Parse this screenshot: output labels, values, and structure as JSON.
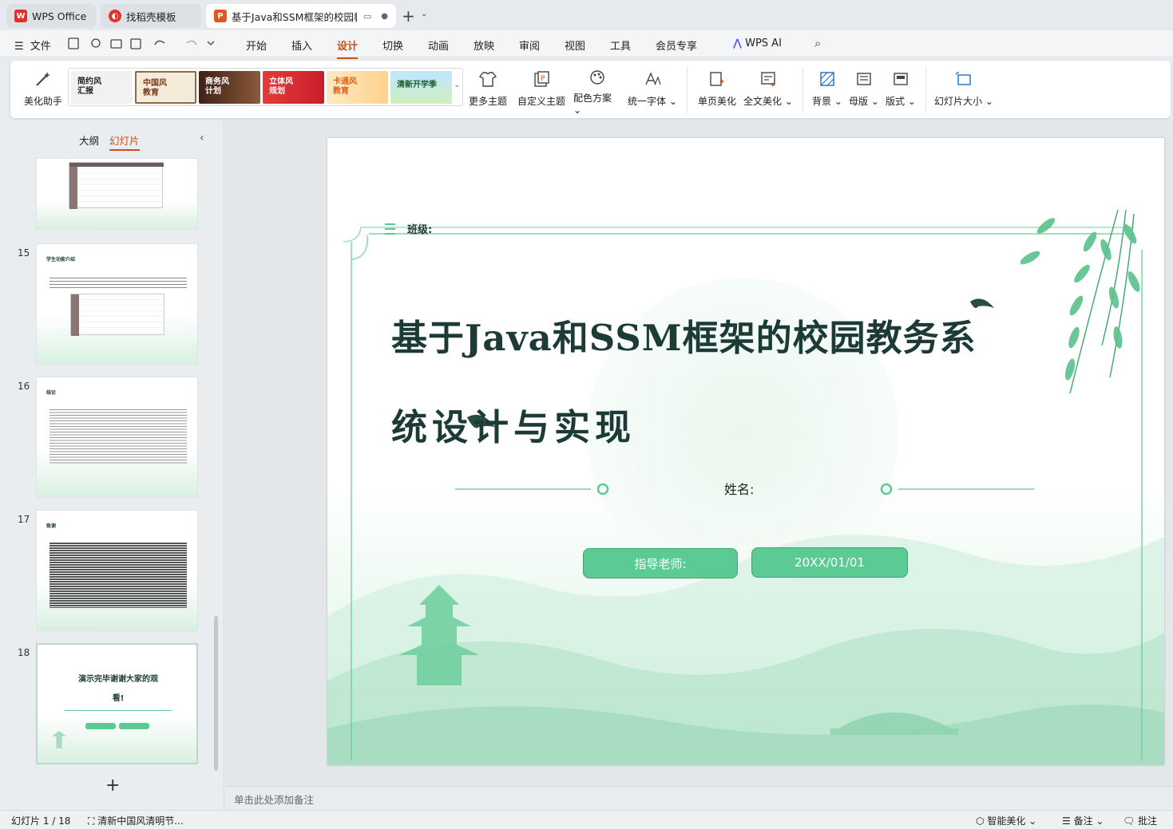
{
  "window": {
    "tabs": [
      {
        "label": "WPS Office",
        "icon": "wps-logo-icon"
      },
      {
        "label": "找稻壳模板",
        "icon": "docer-icon"
      },
      {
        "label": "基于Java和SSM框架的校园教",
        "icon": "ppt-file-icon"
      }
    ],
    "accent": "#c8501b"
  },
  "menu": {
    "file": "文件",
    "items": [
      "开始",
      "插入",
      "设计",
      "切换",
      "动画",
      "放映",
      "审阅",
      "视图",
      "工具",
      "会员专享"
    ],
    "active": "设计",
    "ai": "WPS AI"
  },
  "ribbon": {
    "beautify": "美化助手",
    "themes": [
      {
        "label": "简约风\n汇报"
      },
      {
        "label": "中国风\n教育"
      },
      {
        "label": "商务风\n计划"
      },
      {
        "label": "立体风\n规划"
      },
      {
        "label": "卡通风\n教育"
      },
      {
        "label": "清新开学季"
      }
    ],
    "more_theme": "更多主题",
    "custom_theme": "自定义主题",
    "color_scheme": "配色方案",
    "unify_font": "统一字体",
    "single_beautify": "单页美化",
    "full_beautify": "全文美化",
    "background": "背景",
    "master": "母版",
    "layout": "版式",
    "slide_size": "幻灯片大小"
  },
  "left_panel": {
    "tab_outline": "大纲",
    "tab_slides": "幻灯片",
    "thumbnails": [
      {
        "num": "",
        "title": ""
      },
      {
        "num": "15",
        "title": "学生功能介绍"
      },
      {
        "num": "16",
        "title": "结论"
      },
      {
        "num": "17",
        "title": "致谢"
      },
      {
        "num": "18",
        "title": "演示完毕谢谢大家的观看!"
      }
    ],
    "add": "+"
  },
  "slide": {
    "class_label": "班级:",
    "title_line1": "基于Java和SSM框架的校园教务系",
    "title_line2": "统设计与实现",
    "name_label": "姓名:",
    "teacher_label": "指导老师:",
    "date": "20XX/01/01",
    "accent": "#5ccb93",
    "title_color": "#1c3b36"
  },
  "notes": {
    "placeholder": "单击此处添加备注"
  },
  "status": {
    "slide_count": "幻灯片 1 / 18",
    "theme_name": "清新中国风清明节...",
    "smart": "智能美化",
    "notes": "备注",
    "comments": "批注"
  }
}
